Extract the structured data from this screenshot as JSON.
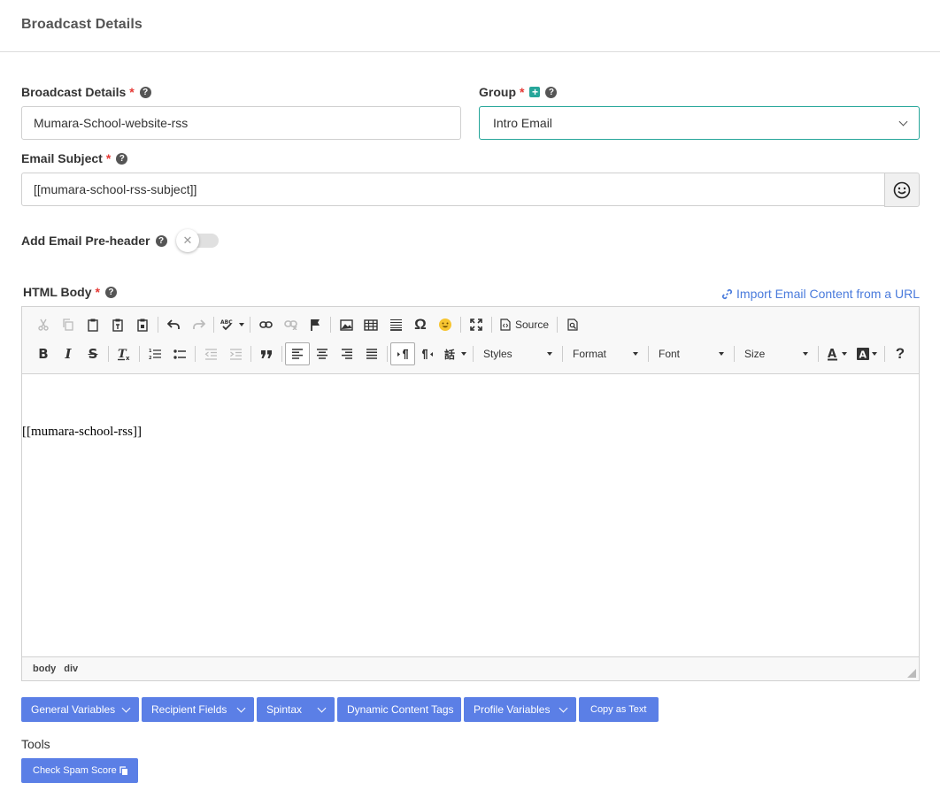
{
  "header": {
    "title": "Broadcast Details"
  },
  "form": {
    "broadcast_details": {
      "label": "Broadcast Details",
      "required": "*",
      "help": "?",
      "value": "Mumara-School-website-rss"
    },
    "group": {
      "label": "Group",
      "required": "*",
      "help": "?",
      "add": "+",
      "value": "Intro Email"
    },
    "email_subject": {
      "label": "Email Subject",
      "required": "*",
      "help": "?",
      "value": "[[mumara-school-rss-subject]]"
    },
    "preheader": {
      "label": "Add Email Pre-header",
      "help": "?",
      "toggle_icon": "✕",
      "enabled": false
    },
    "html_body": {
      "label": "HTML Body",
      "required": "*",
      "help": "?"
    },
    "import_link": "Import Email Content from a URL"
  },
  "editor": {
    "toolbar": {
      "source_label": "Source",
      "styles_label": "Styles",
      "format_label": "Format",
      "font_label": "Font",
      "size_label": "Size",
      "bold": "B",
      "italic": "I",
      "strike": "S",
      "omega": "Ω",
      "help": "?"
    },
    "content": "[[mumara-school-rss]]",
    "path": [
      "body",
      "div"
    ]
  },
  "buttons": {
    "general_variables": "General Variables",
    "recipient_fields": "Recipient Fields",
    "spintax": "Spintax",
    "dynamic_content_tags": "Dynamic Content Tags",
    "profile_variables": "Profile Variables",
    "copy_as_text": "Copy as Text"
  },
  "tools": {
    "label": "Tools",
    "check_spam_score": "Check Spam Score"
  },
  "colors": {
    "accent": "#5b7fe6",
    "teal": "#26a69a",
    "required": "#e53935",
    "link": "#4a7bdc"
  }
}
